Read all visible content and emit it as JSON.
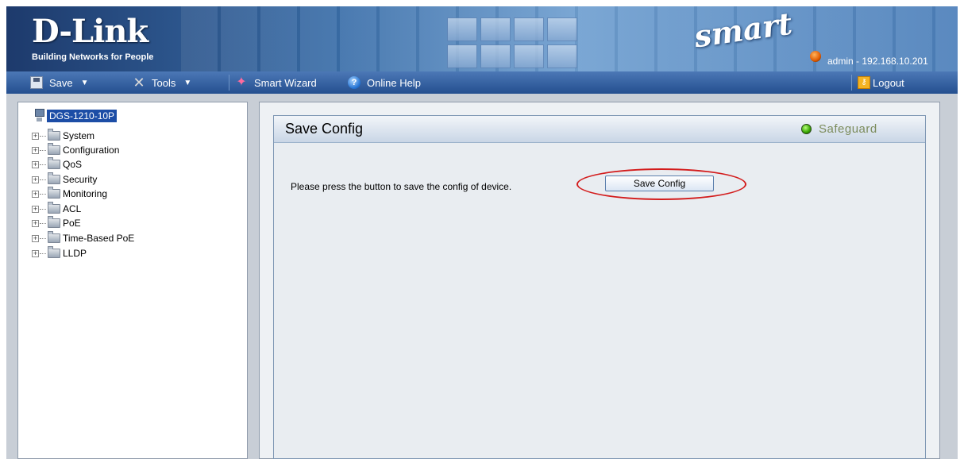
{
  "header": {
    "brand": "D-Link",
    "tagline": "Building Networks for People",
    "product": "smart",
    "user_info": "admin - 192.168.10.201"
  },
  "toolbar": {
    "save_label": "Save",
    "tools_label": "Tools",
    "wizard_label": "Smart Wizard",
    "help_label": "Online Help",
    "logout_label": "Logout"
  },
  "tree": {
    "root": "DGS-1210-10P",
    "items": [
      "System",
      "Configuration",
      "QoS",
      "Security",
      "Monitoring",
      "ACL",
      "PoE",
      "Time-Based PoE",
      "LLDP"
    ]
  },
  "content": {
    "title": "Save Config",
    "safeguard_label": "Safeguard",
    "prompt": "Please press the button to save the config of device.",
    "button_label": "Save Config"
  },
  "colors": {
    "toolbar_bg": "#244f8f",
    "selected_item": "#1c4da6",
    "highlight": "#d31c1c",
    "safeguard_indicator": "#35a400"
  }
}
